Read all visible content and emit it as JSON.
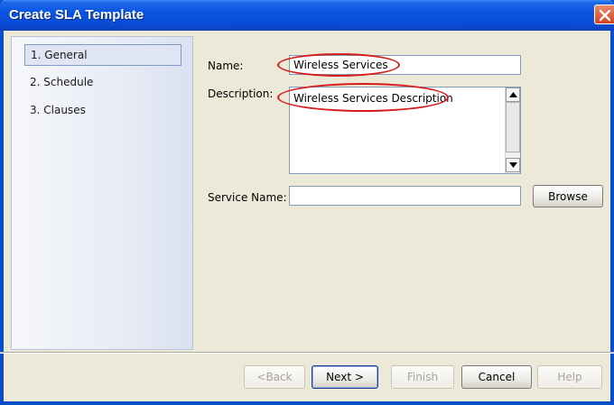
{
  "window": {
    "title": "Create SLA Template"
  },
  "nav": {
    "items": [
      {
        "label": "1. General",
        "selected": true
      },
      {
        "label": "2. Schedule",
        "selected": false
      },
      {
        "label": "3. Clauses",
        "selected": false
      }
    ]
  },
  "form": {
    "name_label": "Name:",
    "name_value": "Wireless Services",
    "description_label": "Description:",
    "description_value": "Wireless Services Description",
    "service_name_label": "Service Name:",
    "service_name_value": "",
    "browse_label": "Browse"
  },
  "footer": {
    "back_label": "<Back",
    "next_label": "Next >",
    "finish_label": "Finish",
    "cancel_label": "Cancel",
    "help_label": "Help"
  },
  "colors": {
    "titlebar": "#0a4fc9",
    "annotation": "#d61c1c",
    "dialog_bg": "#ece9d8"
  }
}
